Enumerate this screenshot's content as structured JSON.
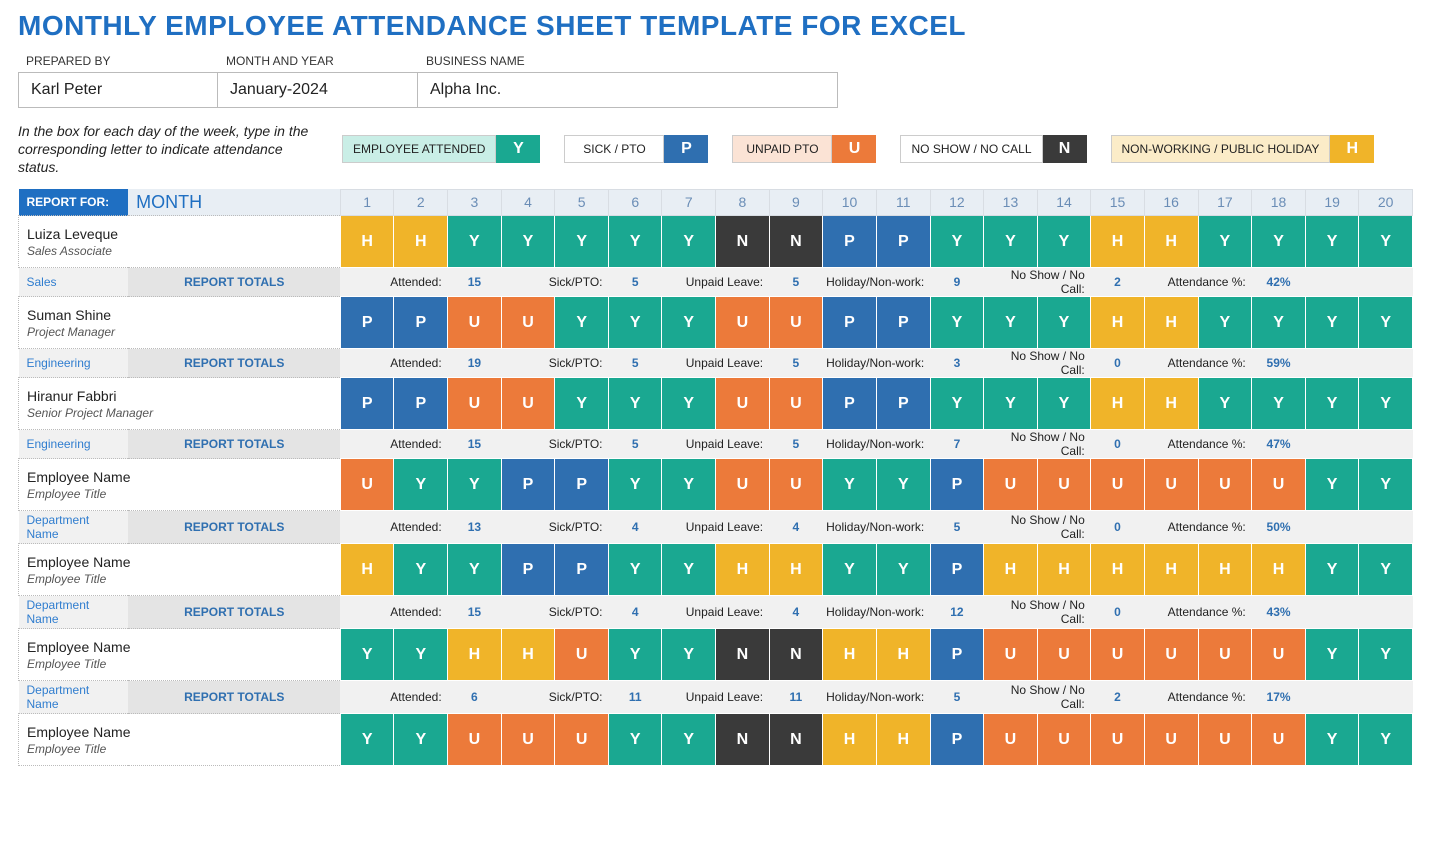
{
  "title": "MONTHLY EMPLOYEE ATTENDANCE SHEET TEMPLATE FOR EXCEL",
  "meta": {
    "prepared_by_label": "PREPARED BY",
    "prepared_by": "Karl Peter",
    "month_year_label": "MONTH AND YEAR",
    "month_year": "January-2024",
    "business_label": "BUSINESS NAME",
    "business": "Alpha Inc."
  },
  "instructions": "In the box for each day of the week, type in the corresponding letter to indicate attendance status.",
  "legend": {
    "y": {
      "label": "EMPLOYEE ATTENDED",
      "code": "Y"
    },
    "p": {
      "label": "SICK / PTO",
      "code": "P"
    },
    "u": {
      "label": "UNPAID PTO",
      "code": "U"
    },
    "n": {
      "label": "NO SHOW / NO CALL",
      "code": "N"
    },
    "h": {
      "label": "NON-WORKING / PUBLIC HOLIDAY",
      "code": "H"
    }
  },
  "report_for_label": "REPORT FOR:",
  "month_header": "MONTH",
  "report_totals_label": "REPORT TOTALS",
  "days": [
    "1",
    "2",
    "3",
    "4",
    "5",
    "6",
    "7",
    "8",
    "9",
    "10",
    "11",
    "12",
    "13",
    "14",
    "15",
    "16",
    "17",
    "18",
    "19",
    "20"
  ],
  "totals_labels": {
    "attended": "Attended:",
    "sick": "Sick/PTO:",
    "unpaid": "Unpaid Leave:",
    "holiday": "Holiday/Non-work:",
    "noshow": "No Show / No Call:",
    "pct": "Attendance %:"
  },
  "employees": [
    {
      "name": "Luiza Leveque",
      "title": "Sales Associate",
      "dept": "Sales",
      "days": [
        "H",
        "H",
        "Y",
        "Y",
        "Y",
        "Y",
        "Y",
        "N",
        "N",
        "P",
        "P",
        "Y",
        "Y",
        "Y",
        "H",
        "H",
        "Y",
        "Y",
        "Y",
        "Y"
      ],
      "totals": {
        "attended": "15",
        "sick": "5",
        "unpaid": "5",
        "holiday": "9",
        "noshow": "2",
        "pct": "42%"
      }
    },
    {
      "name": "Suman Shine",
      "title": "Project Manager",
      "dept": "Engineering",
      "days": [
        "P",
        "P",
        "U",
        "U",
        "Y",
        "Y",
        "Y",
        "U",
        "U",
        "P",
        "P",
        "Y",
        "Y",
        "Y",
        "H",
        "H",
        "Y",
        "Y",
        "Y",
        "Y"
      ],
      "totals": {
        "attended": "19",
        "sick": "5",
        "unpaid": "5",
        "holiday": "3",
        "noshow": "0",
        "pct": "59%"
      }
    },
    {
      "name": "Hiranur Fabbri",
      "title": "Senior Project Manager",
      "dept": "Engineering",
      "days": [
        "P",
        "P",
        "U",
        "U",
        "Y",
        "Y",
        "Y",
        "U",
        "U",
        "P",
        "P",
        "Y",
        "Y",
        "Y",
        "H",
        "H",
        "Y",
        "Y",
        "Y",
        "Y"
      ],
      "totals": {
        "attended": "15",
        "sick": "5",
        "unpaid": "5",
        "holiday": "7",
        "noshow": "0",
        "pct": "47%"
      }
    },
    {
      "name": "Employee Name",
      "title": "Employee Title",
      "dept": "Department Name",
      "days": [
        "U",
        "Y",
        "Y",
        "P",
        "P",
        "Y",
        "Y",
        "U",
        "U",
        "Y",
        "Y",
        "P",
        "U",
        "U",
        "U",
        "U",
        "U",
        "U",
        "Y",
        "Y"
      ],
      "totals": {
        "attended": "13",
        "sick": "4",
        "unpaid": "4",
        "holiday": "5",
        "noshow": "0",
        "pct": "50%"
      }
    },
    {
      "name": "Employee Name",
      "title": "Employee Title",
      "dept": "Department Name",
      "days": [
        "H",
        "Y",
        "Y",
        "P",
        "P",
        "Y",
        "Y",
        "H",
        "H",
        "Y",
        "Y",
        "P",
        "H",
        "H",
        "H",
        "H",
        "H",
        "H",
        "Y",
        "Y"
      ],
      "totals": {
        "attended": "15",
        "sick": "4",
        "unpaid": "4",
        "holiday": "12",
        "noshow": "0",
        "pct": "43%"
      }
    },
    {
      "name": "Employee Name",
      "title": "Employee Title",
      "dept": "Department Name",
      "days": [
        "Y",
        "Y",
        "H",
        "H",
        "U",
        "Y",
        "Y",
        "N",
        "N",
        "H",
        "H",
        "P",
        "U",
        "U",
        "U",
        "U",
        "U",
        "U",
        "Y",
        "Y"
      ],
      "totals": {
        "attended": "6",
        "sick": "11",
        "unpaid": "11",
        "holiday": "5",
        "noshow": "2",
        "pct": "17%"
      }
    },
    {
      "name": "Employee Name",
      "title": "Employee Title",
      "dept": "",
      "days": [
        "Y",
        "Y",
        "U",
        "U",
        "U",
        "Y",
        "Y",
        "N",
        "N",
        "H",
        "H",
        "P",
        "U",
        "U",
        "U",
        "U",
        "U",
        "U",
        "Y",
        "Y"
      ],
      "totals": null
    }
  ]
}
